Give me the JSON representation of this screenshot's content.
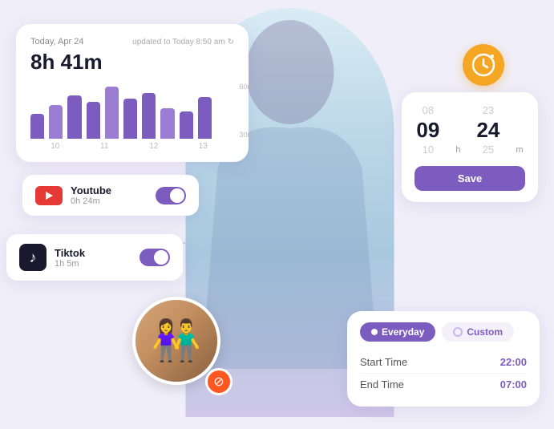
{
  "chart": {
    "date": "Today, Apr 24",
    "updated": "updated to Today 8:50 am",
    "total_time": "8h 41m",
    "y_labels": [
      "60m",
      "30m"
    ],
    "x_labels": [
      "10",
      "11",
      "12",
      "13"
    ],
    "bars": [
      40,
      55,
      70,
      60,
      85,
      65,
      75,
      50,
      45,
      68
    ]
  },
  "youtube": {
    "name": "Youtube",
    "time": "0h 24m",
    "toggle_on": true
  },
  "tiktok": {
    "name": "Tiktok",
    "time": "1h 5m",
    "toggle_on": true
  },
  "time_picker": {
    "hours_above": "08",
    "hours_current": "09",
    "hours_unit": "h",
    "hours_below": "10",
    "minutes_above": "23",
    "minutes_current": "24",
    "minutes_unit": "m",
    "minutes_below": "25",
    "save_label": "Save"
  },
  "schedule": {
    "tab_everyday": "Everyday",
    "tab_custom": "Custom",
    "start_time_label": "Start Time",
    "start_time_value": "22:00",
    "end_time_label": "End Time",
    "end_time_value": "07:00"
  }
}
